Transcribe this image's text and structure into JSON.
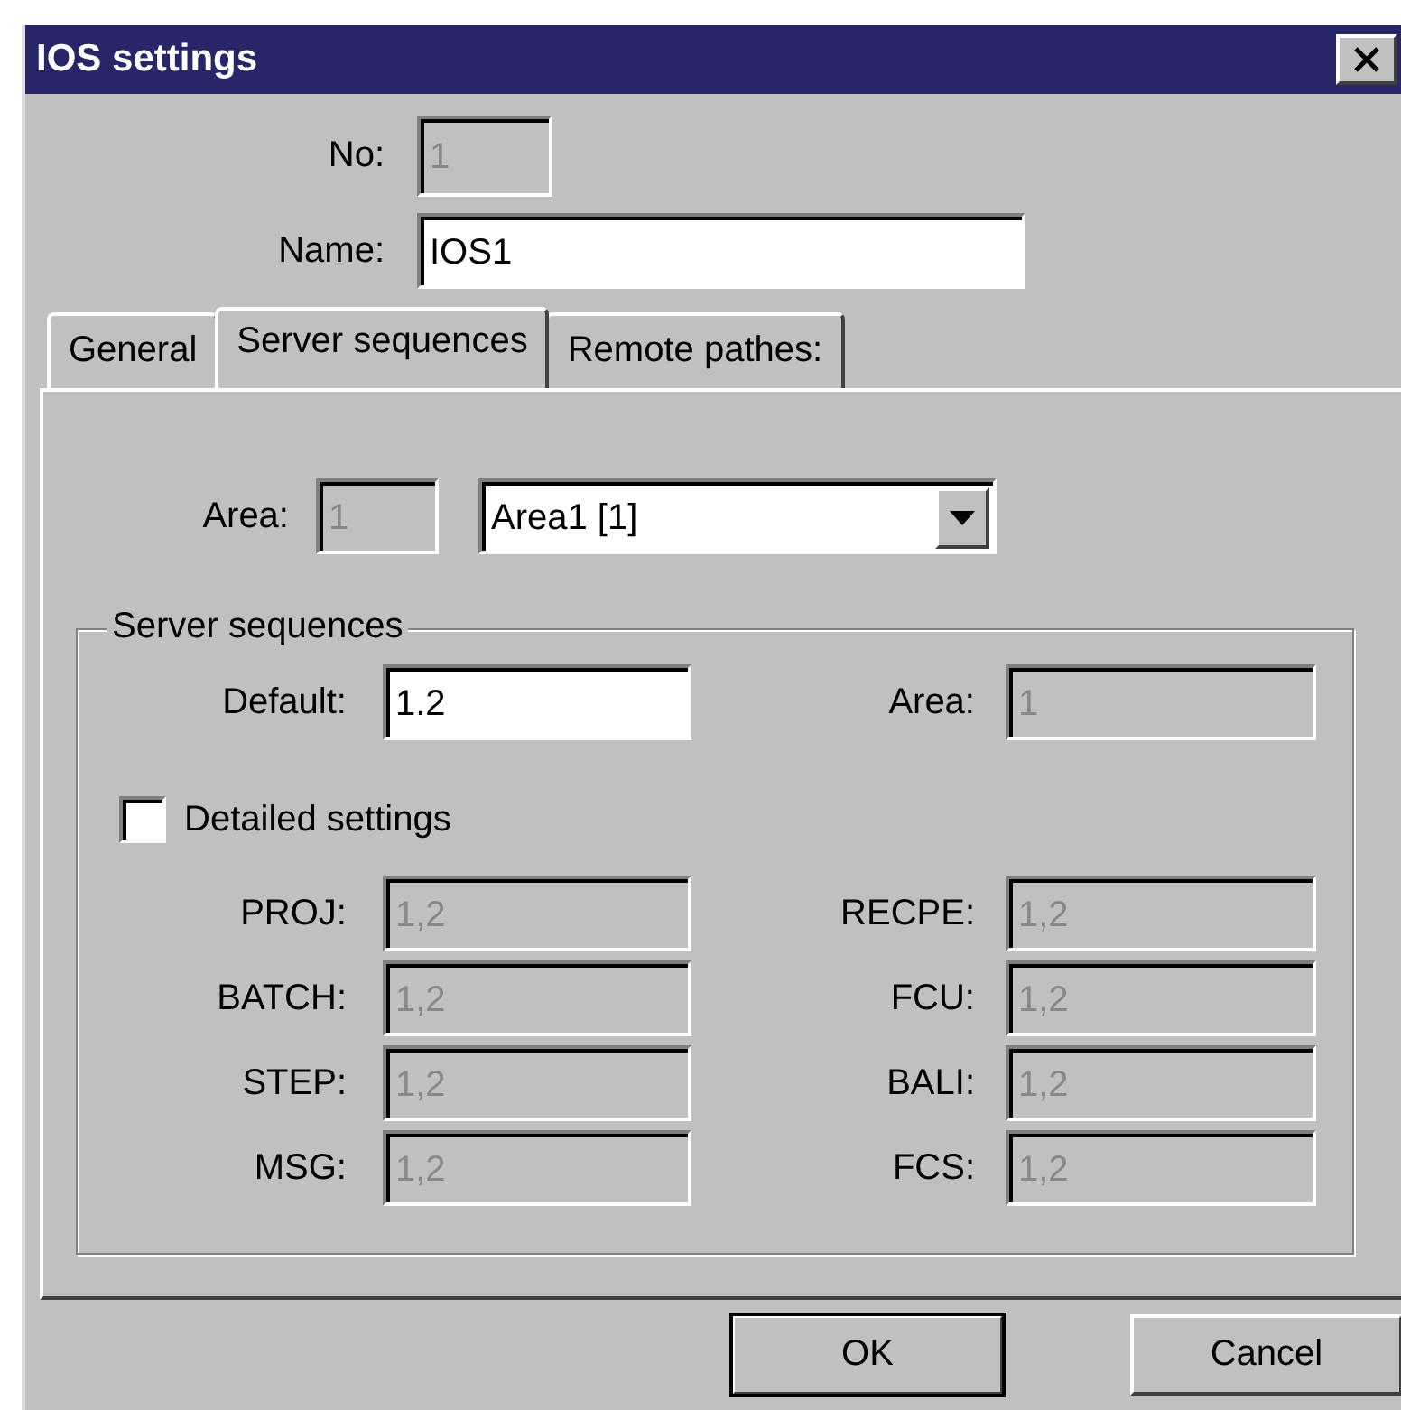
{
  "window": {
    "title": "IOS settings"
  },
  "no": {
    "label": "No:",
    "value": "1",
    "disabled": true
  },
  "name": {
    "label": "Name:",
    "value": "IOS1",
    "disabled": false
  },
  "tabs": [
    {
      "label": "General",
      "selected": false
    },
    {
      "label": "Server sequences",
      "selected": true
    },
    {
      "label": "Remote pathes:",
      "selected": false
    }
  ],
  "area": {
    "label": "Area:",
    "value": "1",
    "disabled": true,
    "dropdown": "Area1 [1]"
  },
  "group": {
    "title": "Server sequences",
    "default": {
      "label": "Default:",
      "value": "1.2",
      "disabled": false
    },
    "area": {
      "label": "Area:",
      "value": "1",
      "disabled": true
    },
    "detailed": {
      "label": "Detailed settings",
      "checked": false
    },
    "rows": [
      {
        "left": {
          "label": "PROJ:",
          "value": "1,2",
          "disabled": true
        },
        "right": {
          "label": "RECPE:",
          "value": "1,2",
          "disabled": true
        }
      },
      {
        "left": {
          "label": "BATCH:",
          "value": "1,2",
          "disabled": true
        },
        "right": {
          "label": "FCU:",
          "value": "1,2",
          "disabled": true
        }
      },
      {
        "left": {
          "label": "STEP:",
          "value": "1,2",
          "disabled": true
        },
        "right": {
          "label": "BALI:",
          "value": "1,2",
          "disabled": true
        }
      },
      {
        "left": {
          "label": "MSG:",
          "value": "1,2",
          "disabled": true
        },
        "right": {
          "label": "FCS:",
          "value": "1,2",
          "disabled": true
        }
      }
    ]
  },
  "buttons": [
    {
      "label": "OK",
      "default": true
    },
    {
      "label": "Cancel",
      "default": false
    }
  ]
}
